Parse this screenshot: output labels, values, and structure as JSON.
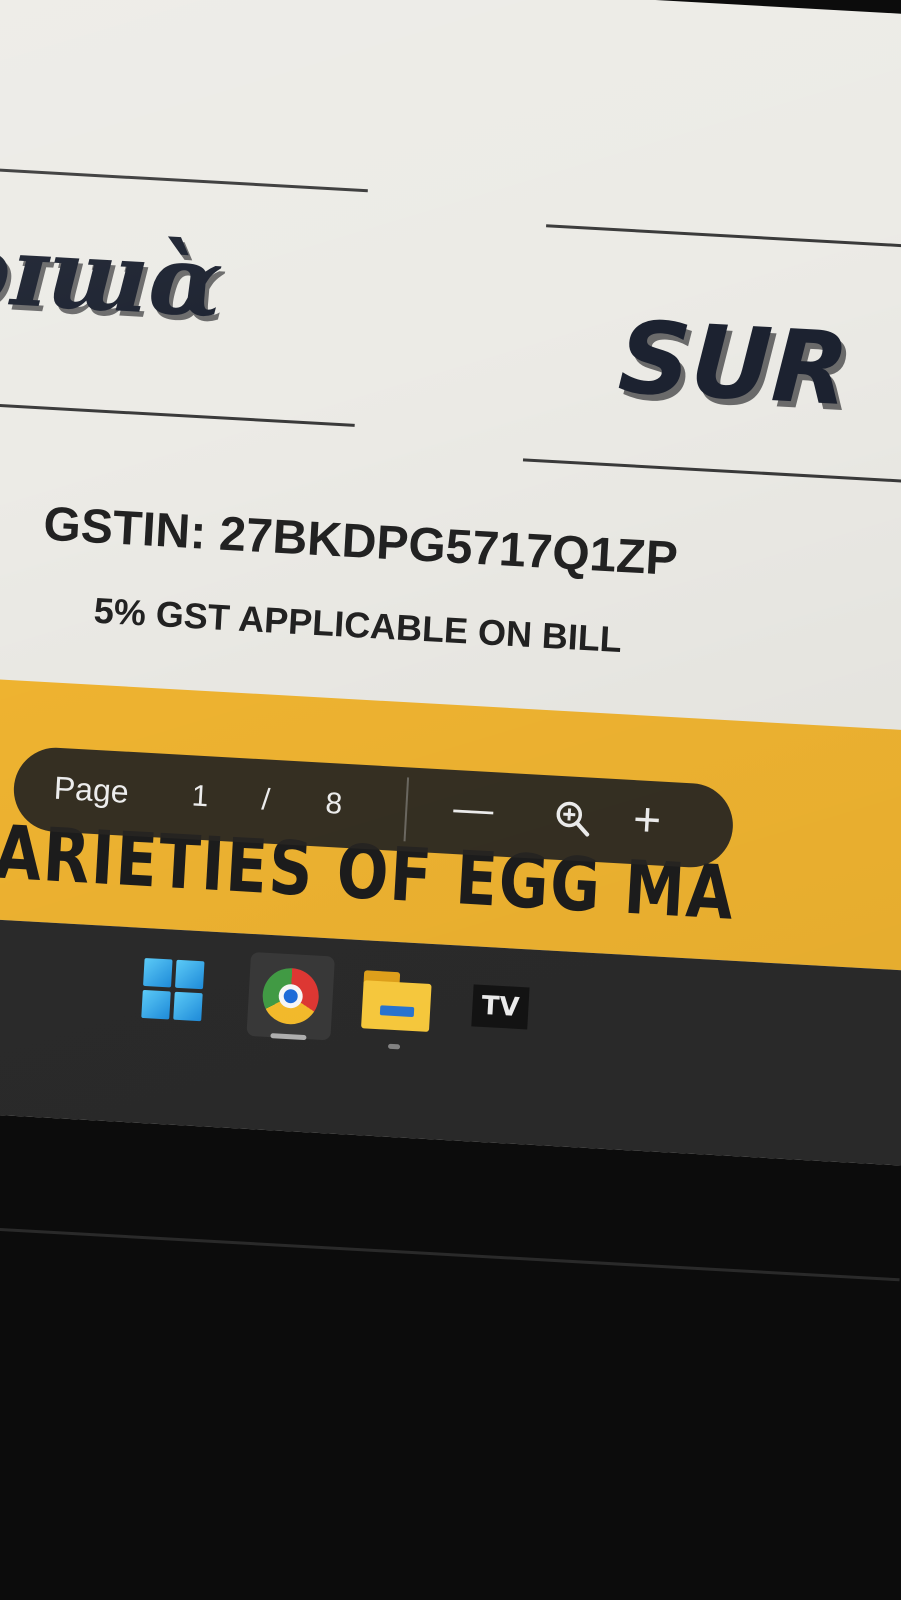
{
  "document": {
    "logo_left_text": "ɔɪɯɑ̀",
    "logo_right_text": "SUR",
    "gstin_line": "GSTIN: 27BKDPG5717Q1ZP",
    "gst_note": "5% GST APPLICABLE ON BILL",
    "band_heading": "VARIETIES OF EGG MA",
    "band_color": "#f1b531"
  },
  "pdf_toolbar": {
    "page_label": "Page",
    "current_page": "1",
    "separator": "/",
    "total_pages": "8",
    "zoom_out_symbol": "—",
    "zoom_in_symbol": "+",
    "fit_icon": "magnifier-plus-icon"
  },
  "taskbar": {
    "items": [
      {
        "icon": "windows-start-icon"
      },
      {
        "icon": "chrome-icon",
        "active": true
      },
      {
        "icon": "file-explorer-icon"
      },
      {
        "icon": "tradingview-icon",
        "label": "TV"
      }
    ]
  }
}
